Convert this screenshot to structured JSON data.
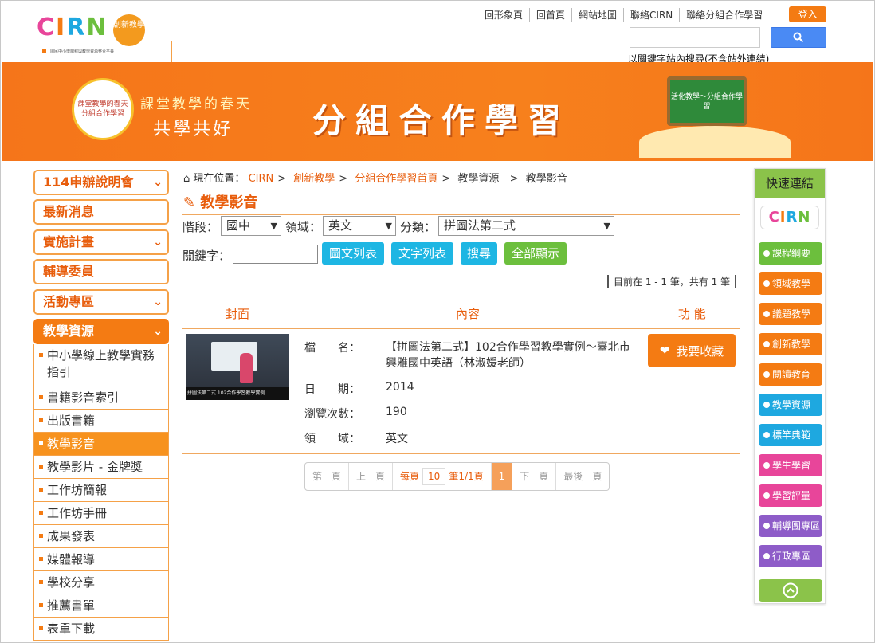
{
  "header": {
    "logo_text": "CIRN",
    "logo_sub": "國民中小學課程與教學資源整合平臺",
    "logo_badge": "創新教學",
    "nav": [
      "回形象頁",
      "回首頁",
      "網站地圖",
      "聯絡CIRN",
      "聯絡分組合作學習"
    ],
    "login_label": "登入",
    "search_placeholder": "",
    "search_note": "以關鍵字站內搜尋(不含站外連結)"
  },
  "banner": {
    "seal_text": "課堂教學的春天 分組合作學習",
    "slogan_line1": "課堂教學的春天",
    "slogan_line2": "共學共好",
    "title": "分組合作學習",
    "board_text": "活化教學～分組合作學習"
  },
  "left_menu": {
    "sections": [
      {
        "label": "114申辦說明會",
        "has_chevron": true
      },
      {
        "label": "最新消息",
        "has_chevron": false
      },
      {
        "label": "實施計畫",
        "has_chevron": true
      },
      {
        "label": "輔導委員",
        "has_chevron": false
      },
      {
        "label": "活動專區",
        "has_chevron": true
      },
      {
        "label": "教學資源",
        "has_chevron": true
      }
    ],
    "sub_items": [
      "中小學線上教學實務指引",
      "書籍影音索引",
      "出版書籍",
      "教學影音",
      "教學影片 - 金牌獎",
      "工作坊簡報",
      "工作坊手冊",
      "成果發表",
      "媒體報導",
      "學校分享",
      "推薦書單",
      "表單下載"
    ],
    "active_sub": "教學影音"
  },
  "breadcrumb": {
    "prefix": "現在位置：",
    "items": [
      "CIRN",
      "創新教學",
      "分組合作學習首頁",
      "教學資源",
      "教學影音"
    ]
  },
  "page_title": "教學影音",
  "filters": {
    "stage_label": "階段：",
    "stage_value": "國中",
    "domain_label": "領域：",
    "domain_value": "英文",
    "category_label": "分類：",
    "category_value": "拼圖法第二式",
    "keyword_label": "關鍵字：",
    "keyword_value": "",
    "buttons": [
      "圖文列表",
      "文字列表",
      "搜尋",
      "全部顯示"
    ]
  },
  "result_count": "目前在 1 - 1 筆，共有 1 筆",
  "table": {
    "headers": [
      "封面",
      "內容",
      "功 能"
    ],
    "rows": [
      {
        "thumb_caption": "拼圖法第二式 102合作學習教學實例",
        "file_label": "檔　　名：",
        "file_value": "【拼圖法第二式】102合作學習教學實例～臺北市興雅國中英語（林淑媛老師）",
        "date_label": "日　　期：",
        "date_value": "2014",
        "views_label": "瀏覽次數：",
        "views_value": "190",
        "domain_label": "領　　域：",
        "domain_value": "英文",
        "fav_label": "我要收藏"
      }
    ]
  },
  "pagination": {
    "first": "第一頁",
    "prev": "上一頁",
    "per_page_label": "每頁",
    "per_page_value": "10",
    "page_info": "筆1/1頁",
    "current": "1",
    "next": "下一頁",
    "last": "最後一頁"
  },
  "quick_links": {
    "title": "快速連結",
    "logo_text": "CIRN",
    "items": [
      {
        "label": "課程綱要",
        "color": "#6cbf3d"
      },
      {
        "label": "領域教學",
        "color": "#f47b13"
      },
      {
        "label": "議題教學",
        "color": "#f47b13"
      },
      {
        "label": "創新教學",
        "color": "#f47b13"
      },
      {
        "label": "閱讀教育",
        "color": "#f47b13"
      },
      {
        "label": "教學資源",
        "color": "#1ea8e0"
      },
      {
        "label": "標竿典範",
        "color": "#1ea8e0"
      },
      {
        "label": "學生學習",
        "color": "#e8459a"
      },
      {
        "label": "學習評量",
        "color": "#e8459a"
      },
      {
        "label": "輔導團專區",
        "color": "#8e5cc8"
      },
      {
        "label": "行政專區",
        "color": "#8e5cc8"
      }
    ]
  },
  "colors": {
    "accent": "#f47b13",
    "accent_text": "#e85d0c",
    "quick_header": "#8bc34a",
    "filter_btn_blue": "#1eb6e3",
    "filter_btn_green": "#6cbf3d"
  }
}
